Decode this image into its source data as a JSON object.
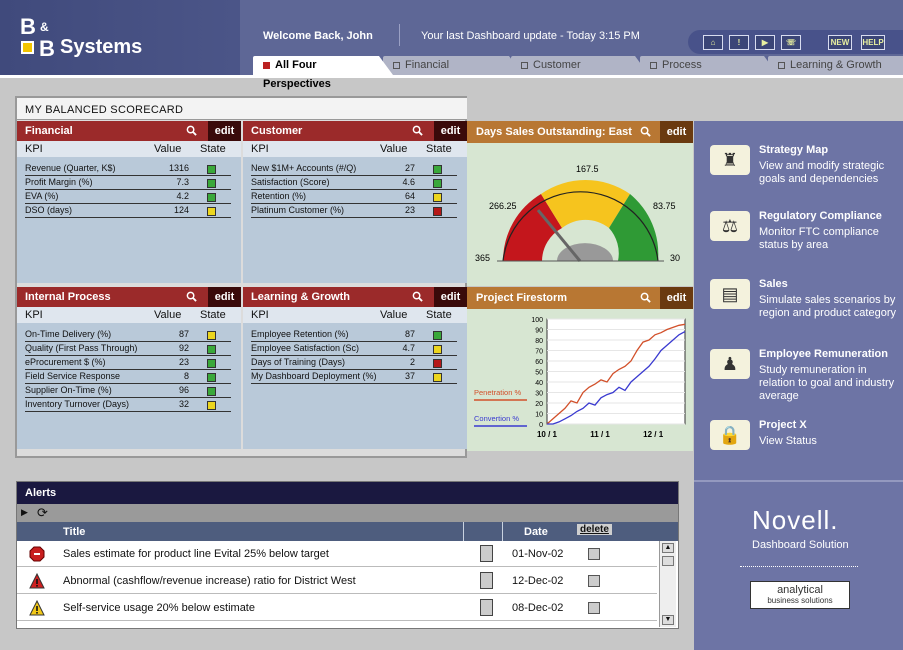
{
  "app": {
    "logo_b1": "B",
    "logo_amp": "&",
    "logo_b2": "B",
    "logo_name": "Systems"
  },
  "header": {
    "welcome": "Welcome Back,  John",
    "last_update": "Your last Dashboard update - Today 3:15 PM",
    "toolbar": [
      "home",
      "info",
      "play",
      "phone",
      "NEW",
      "HELP"
    ]
  },
  "tabs": [
    {
      "label": "All Four Perspectives",
      "active": true
    },
    {
      "label": "Financial"
    },
    {
      "label": "Customer"
    },
    {
      "label": "Process"
    },
    {
      "label": "Learning & Growth"
    }
  ],
  "scorecard": {
    "title": "MY BALANCED SCORECARD",
    "col_kpi": "KPI",
    "col_value": "Value",
    "col_state": "State",
    "edit": "edit",
    "panels": [
      {
        "title": "Financial",
        "rows": [
          {
            "k": "Revenue (Quarter, K$)",
            "v": "1316",
            "s": "green"
          },
          {
            "k": "Profit Margin (%)",
            "v": "7.3",
            "s": "green"
          },
          {
            "k": "EVA (%)",
            "v": "4.2",
            "s": "green"
          },
          {
            "k": "DSO (days)",
            "v": "124",
            "s": "yellow"
          }
        ]
      },
      {
        "title": "Customer",
        "rows": [
          {
            "k": "New $1M+ Accounts (#/Q)",
            "v": "27",
            "s": "green"
          },
          {
            "k": "Satisfaction (Score)",
            "v": "4.6",
            "s": "green"
          },
          {
            "k": "Retention (%)",
            "v": "64",
            "s": "yellow"
          },
          {
            "k": "Platinum Customer (%)",
            "v": "23",
            "s": "red"
          }
        ]
      },
      {
        "title": "Internal Process",
        "rows": [
          {
            "k": "On-Time Delivery (%)",
            "v": "87",
            "s": "yellow"
          },
          {
            "k": "Quality (First Pass Through)",
            "v": "92",
            "s": "green"
          },
          {
            "k": "eProcurement $ (%)",
            "v": "23",
            "s": "green"
          },
          {
            "k": "Field Service Response",
            "v": "8",
            "s": "green"
          },
          {
            "k": "Supplier On-Time (%)",
            "v": "96",
            "s": "green"
          },
          {
            "k": "Inventory Turnover (Days)",
            "v": "32",
            "s": "yellow"
          }
        ]
      },
      {
        "title": "Learning & Growth",
        "rows": [
          {
            "k": "Employee Retention (%)",
            "v": "87",
            "s": "green"
          },
          {
            "k": "Employee Satisfaction (Sc)",
            "v": "4.7",
            "s": "yellow"
          },
          {
            "k": "Days of Training (Days)",
            "v": "2",
            "s": "red"
          },
          {
            "k": "My Dashboard Deployment (%)",
            "v": "37",
            "s": "yellow"
          }
        ]
      }
    ]
  },
  "gauge": {
    "title": "Days Sales Outstanding: East",
    "edit": "edit",
    "labels": [
      "365",
      "266.25",
      "167.5",
      "83.75",
      "30"
    ],
    "value": 124,
    "min": 30,
    "max": 365
  },
  "firestorm": {
    "title": "Project Firestorm",
    "edit": "edit",
    "legend": [
      "Penetration %",
      "Convertion %"
    ],
    "colors": {
      "penetration": "#d2502a",
      "convertion": "#3a3ad0"
    },
    "yticks": [
      "0",
      "10",
      "20",
      "30",
      "40",
      "50",
      "60",
      "70",
      "80",
      "90",
      "100"
    ],
    "xticks": [
      "10 / 1",
      "11 / 1",
      "12 / 1"
    ],
    "penetration": [
      0,
      5,
      10,
      15,
      22,
      20,
      30,
      35,
      38,
      42,
      40,
      48,
      52,
      55,
      60,
      70,
      78,
      80,
      85,
      87,
      90,
      92,
      94,
      95
    ],
    "convertion": [
      0,
      0,
      2,
      5,
      8,
      12,
      15,
      20,
      18,
      25,
      28,
      30,
      35,
      32,
      40,
      45,
      50,
      55,
      62,
      70,
      75,
      80,
      85,
      88
    ]
  },
  "sidebar": [
    {
      "title": "Strategy Map",
      "desc": "View and modify strategic goals and dependencies",
      "icon": "chess-icon"
    },
    {
      "title": "Regulatory Compliance",
      "desc": "Monitor FTC compliance status by area",
      "icon": "scales-icon"
    },
    {
      "title": "Sales",
      "desc": "Simulate sales scenarios by region and product category",
      "icon": "sales-icon"
    },
    {
      "title": "Employee Remuneration",
      "desc": "Study remuneration in relation to goal and industry average",
      "icon": "people-icon"
    },
    {
      "title": "Project X",
      "desc": "View Status",
      "icon": "lock-icon"
    }
  ],
  "brand": {
    "novell": "Novell.",
    "novell_sub": "Dashboard Solution",
    "analytical": "analytical",
    "analytical_sub": "business solutions"
  },
  "alerts": {
    "title": "Alerts",
    "col_title": "Title",
    "col_date": "Date",
    "col_delete": "delete",
    "rows": [
      {
        "title": "Sales estimate for product line Evital 25% below target",
        "date": "01-Nov-02",
        "icon": "stop"
      },
      {
        "title": "Abnormal (cashflow/revenue increase) ratio for District West",
        "date": "12-Dec-02",
        "icon": "warn-red"
      },
      {
        "title": "Self-service usage 20% below estimate",
        "date": "08-Dec-02",
        "icon": "warn-yellow"
      }
    ]
  }
}
